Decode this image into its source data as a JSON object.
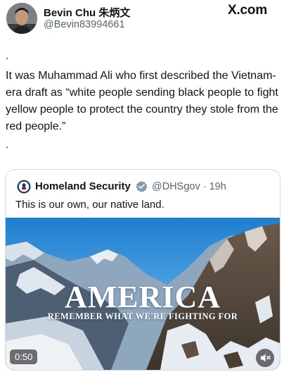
{
  "author": {
    "display_name": "Bevin Chu 朱炳文",
    "handle": "@Bevin83994661"
  },
  "brand": {
    "logo_text": "X.com"
  },
  "tweet": {
    "lead_dot": ".",
    "text": "It was Muhammad Ali who first described the Vietnam-era draft as “white people sending black people to fight yellow people to protect the country they stole from the red people.”",
    "trail_dot": "."
  },
  "quoted": {
    "name": "Homeland Security",
    "handle_time": "@DHSgov · 19h",
    "text": "This is our own, our native land.",
    "video": {
      "title": "AMERICA",
      "subtitle": "REMEMBER WHAT WE'RE FIGHTING FOR",
      "timestamp": "0:50"
    }
  },
  "colors": {
    "verified": "#829aab",
    "text": "#0f1419",
    "muted": "#536471",
    "border": "#cfd9de"
  }
}
